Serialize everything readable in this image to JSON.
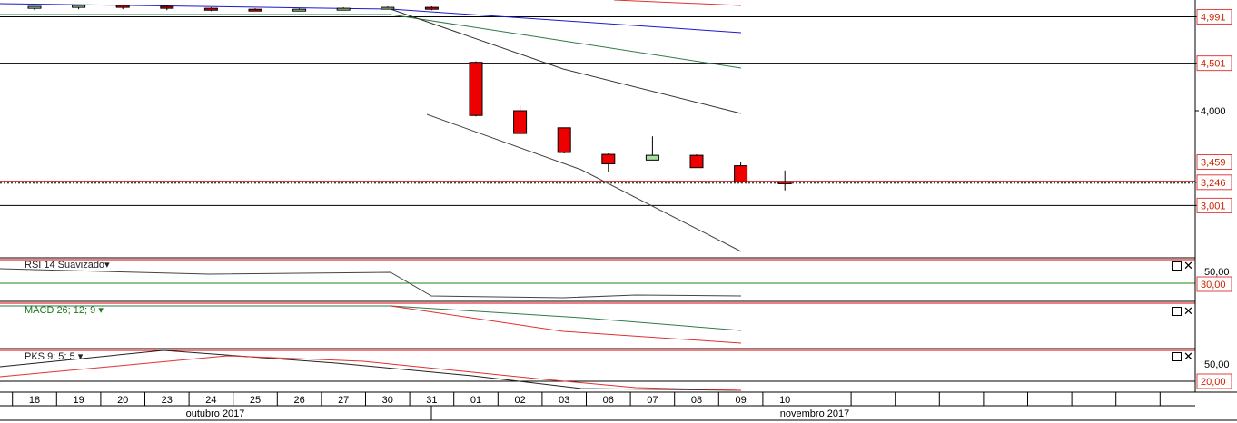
{
  "chart_data": {
    "type": "candlestick",
    "x": [
      "18",
      "19",
      "20",
      "23",
      "24",
      "25",
      "26",
      "27",
      "30",
      "31",
      "01",
      "02",
      "03",
      "06",
      "07",
      "08",
      "09",
      "10"
    ],
    "months": [
      "outubro 2017",
      "novembro 2017"
    ],
    "price_axis_ticks": [
      "4,991",
      "4,501",
      "4,000",
      "3,459",
      "3,246",
      "3,001"
    ],
    "horizontal_lines": [
      4.991,
      4.501,
      3.459,
      3.001
    ],
    "current_price_line": 3.246,
    "candles": [
      {
        "o": 5.08,
        "h": 5.1,
        "c": 5.1,
        "l": 5.06
      },
      {
        "o": 5.09,
        "h": 5.12,
        "c": 5.11,
        "l": 5.07
      },
      {
        "o": 5.11,
        "h": 5.12,
        "c": 5.09,
        "l": 5.07
      },
      {
        "o": 5.1,
        "h": 5.11,
        "c": 5.08,
        "l": 5.06
      },
      {
        "o": 5.08,
        "h": 5.09,
        "c": 5.06,
        "l": 5.05
      },
      {
        "o": 5.07,
        "h": 5.08,
        "c": 5.06,
        "l": 5.05
      },
      {
        "o": 5.07,
        "h": 5.08,
        "c": 5.07,
        "l": 5.05
      },
      {
        "o": 5.08,
        "h": 5.09,
        "c": 5.08,
        "l": 5.06
      },
      {
        "o": 5.08,
        "h": 5.1,
        "c": 5.09,
        "l": 5.07
      },
      {
        "o": 5.09,
        "h": 5.1,
        "c": 5.07,
        "l": 5.06
      },
      {
        "o": 4.51,
        "h": 4.52,
        "c": 3.95,
        "l": 3.94
      },
      {
        "o": 4.0,
        "h": 4.05,
        "c": 3.76,
        "l": 3.75
      },
      {
        "o": 3.82,
        "h": 3.82,
        "c": 3.56,
        "l": 3.55
      },
      {
        "o": 3.54,
        "h": 3.55,
        "c": 3.44,
        "l": 3.35
      },
      {
        "o": 3.48,
        "h": 3.73,
        "c": 3.53,
        "l": 3.48
      },
      {
        "o": 3.53,
        "h": 3.54,
        "c": 3.4,
        "l": 3.4
      },
      {
        "o": 3.42,
        "h": 3.46,
        "c": 3.25,
        "l": 3.24
      },
      {
        "o": 3.25,
        "h": 3.37,
        "c": 3.23,
        "l": 3.16
      }
    ],
    "panes": [
      {
        "label": "RSI 14 Suavizado",
        "ticks": [
          "50,00",
          "30,00"
        ]
      },
      {
        "label": "MACD 26; 12; 9",
        "ticks": []
      },
      {
        "label": "PKS 9; 5; 5",
        "ticks": [
          "50,00",
          "20,00"
        ]
      }
    ]
  }
}
